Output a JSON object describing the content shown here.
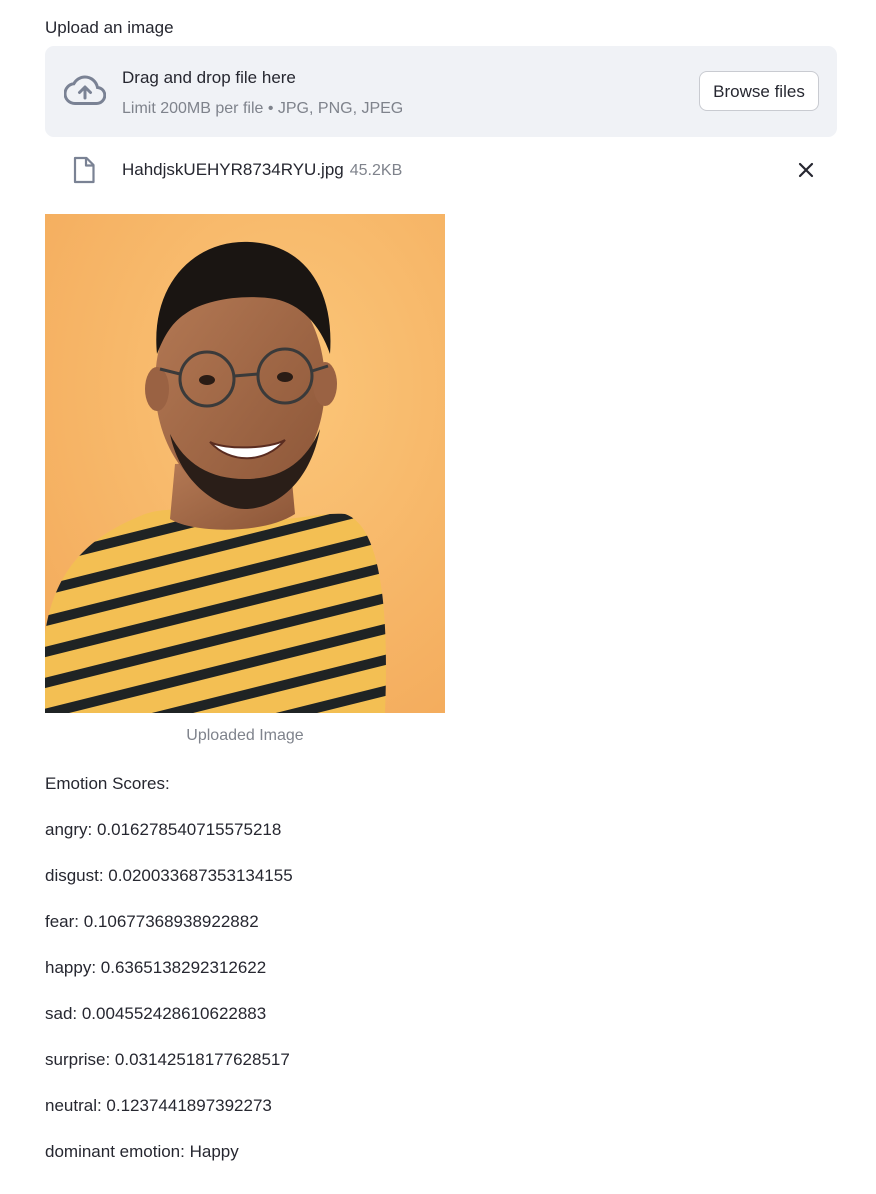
{
  "uploader": {
    "label": "Upload an image",
    "drop_title": "Drag and drop file here",
    "limit_text": "Limit 200MB per file • JPG, PNG, JPEG",
    "browse_label": "Browse files",
    "icon": "cloud-upload-icon"
  },
  "file": {
    "name": "HahdjskUEHYR8734RYU.jpg",
    "size": "45.2KB",
    "icon": "file-icon",
    "remove_icon": "close-icon"
  },
  "image": {
    "caption": "Uploaded Image"
  },
  "results": {
    "heading": "Emotion Scores:",
    "lines": [
      "angry: 0.016278540715575218",
      "disgust: 0.020033687353134155",
      "fear: 0.10677368938922882",
      "happy: 0.6365138292312622",
      "sad: 0.004552428610622883",
      "surprise: 0.03142518177628517",
      "neutral: 0.1237441897392273",
      "dominant emotion: Happy"
    ]
  },
  "colors": {
    "dropzone_bg": "#f0f2f6",
    "text": "#262730",
    "muted_text": "#7f838c",
    "photo_background": "#f7b96a"
  }
}
